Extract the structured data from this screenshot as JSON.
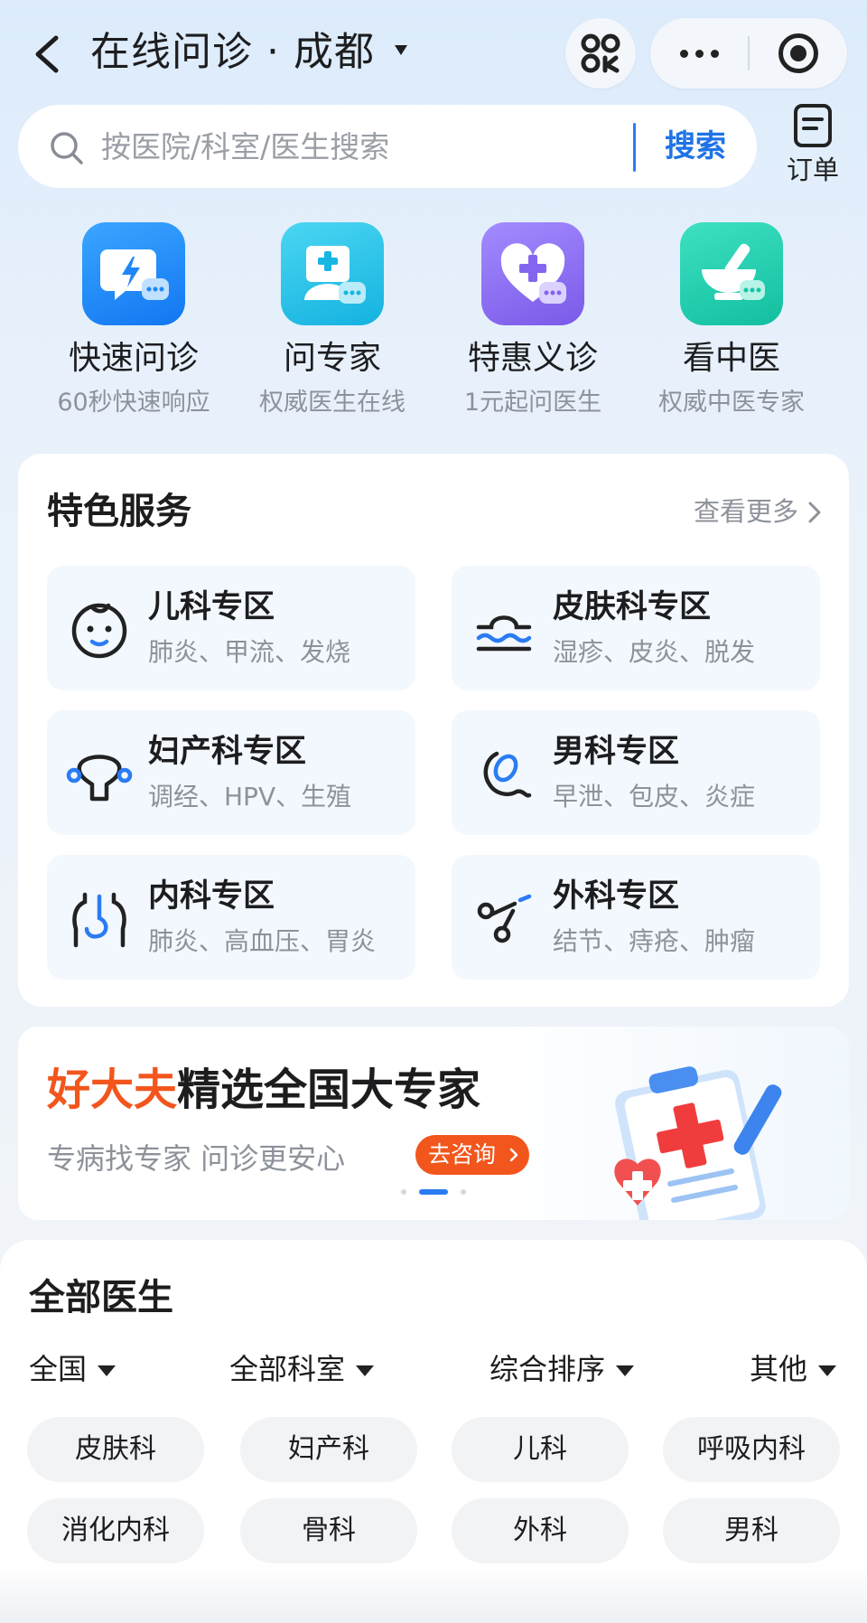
{
  "nav": {
    "title": "在线问诊 · 成都"
  },
  "search": {
    "placeholder": "按医院/科室/医生搜索",
    "button_label": "搜索",
    "orders_label": "订单"
  },
  "quick_entries": [
    {
      "title": "快速问诊",
      "subtitle": "60秒快速响应",
      "icon": "lightning-chat-icon",
      "color": "#1e8cff"
    },
    {
      "title": "问专家",
      "subtitle": "权威医生在线",
      "icon": "doctor-chat-icon",
      "color": "#21c0e8"
    },
    {
      "title": "特惠义诊",
      "subtitle": "1元起问医生",
      "icon": "heart-plus-icon",
      "color": "#8b6cf4"
    },
    {
      "title": "看中医",
      "subtitle": "权威中医专家",
      "icon": "mortar-pestle-icon",
      "color": "#19cfb0"
    }
  ],
  "services": {
    "title": "特色服务",
    "more_label": "查看更多",
    "items": [
      {
        "name": "儿科专区",
        "desc": "肺炎、甲流、发烧",
        "icon": "baby-face-icon"
      },
      {
        "name": "皮肤科专区",
        "desc": "湿疹、皮炎、脱发",
        "icon": "skin-layer-icon"
      },
      {
        "name": "妇产科专区",
        "desc": "调经、HPV、生殖",
        "icon": "uterus-icon"
      },
      {
        "name": "男科专区",
        "desc": "早泄、包皮、炎症",
        "icon": "male-organ-icon"
      },
      {
        "name": "内科专区",
        "desc": "肺炎、高血压、胃炎",
        "icon": "stomach-icon"
      },
      {
        "name": "外科专区",
        "desc": "结节、痔疮、肿瘤",
        "icon": "scissors-icon"
      }
    ]
  },
  "banner": {
    "brand": "好大夫",
    "headline": "精选全国大专家",
    "subtitle": "专病找专家 问诊更安心",
    "cta_label": "去咨询"
  },
  "doctors": {
    "title": "全部医生",
    "filters": [
      "全国",
      "全部科室",
      "综合排序",
      "其他"
    ],
    "departments": [
      "皮肤科",
      "妇产科",
      "儿科",
      "呼吸内科",
      "消化内科",
      "骨科",
      "外科",
      "男科"
    ]
  },
  "colors": {
    "accent": "#1f73e6",
    "brand_orange": "#f2561d"
  }
}
